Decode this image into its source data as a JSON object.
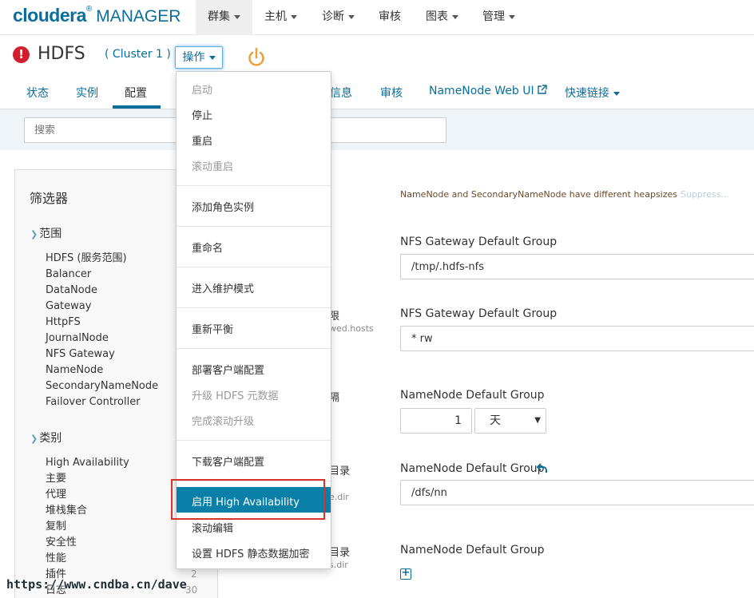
{
  "brand": {
    "name_bold": "cloudera",
    "registered": "®",
    "name_rest": "MANAGER"
  },
  "topnav": [
    {
      "label": "群集",
      "active": true
    },
    {
      "label": "主机"
    },
    {
      "label": "诊断"
    },
    {
      "label": "审核"
    },
    {
      "label": "图表"
    },
    {
      "label": "管理"
    }
  ],
  "service": {
    "title": "HDFS",
    "cluster": "( Cluster 1 )",
    "ops_label": "操作",
    "status_icon": "error-icon",
    "power_icon": "power-icon",
    "power_color": "#e8a33d"
  },
  "tabs": {
    "status": "状态",
    "instances": "实例",
    "config": "配置",
    "info": "信息",
    "audit": "审核",
    "webui": "NameNode Web UI",
    "quicklinks": "快速链接"
  },
  "search": {
    "placeholder": "搜索"
  },
  "filter": {
    "title": "筛选器",
    "scope_head": "范围",
    "scope_items": [
      "HDFS (服务范围)",
      "Balancer",
      "DataNode",
      "Gateway",
      "HttpFS",
      "JournalNode",
      "NFS Gateway",
      "NameNode",
      "SecondaryNameNode",
      "Failover Controller"
    ],
    "category_head": "类别",
    "category_items": [
      "High Availability",
      "主要",
      "代理",
      "堆栈集合",
      "复制",
      "安全性",
      "性能",
      "插件",
      "日志"
    ],
    "count_plugin": "2",
    "count_log": "30"
  },
  "settings": {
    "warning": "NameNode and SecondaryNameNode have different heapsizes",
    "suppress": "Suppress...",
    "group1": "NFS Gateway Default Group",
    "value1": "/tmp/.hdfs-nfs",
    "group2": "NFS Gateway Default Group",
    "value2": "* rw",
    "group3": "NameNode Default Group",
    "num_value": "1",
    "unit_value": "天",
    "group4": "NameNode Default Group",
    "value4": "/dfs/nn",
    "group5": "NameNode Default Group",
    "peek1": "限",
    "peek1_sub": "wed.hosts",
    "peek2": "隔",
    "peek3": "目录",
    "peek3_sub": "e.dir",
    "peek4": "目录",
    "peek4_sub": "s.dir"
  },
  "dropdown": {
    "start": "启动",
    "stop": "停止",
    "restart": "重启",
    "rolling_restart": "滚动重启",
    "add_role": "添加角色实例",
    "rename": "重命名",
    "maintenance": "进入维护模式",
    "rebalance": "重新平衡",
    "deploy_client": "部署客户端配置",
    "upgrade_meta": "升级 HDFS 元数据",
    "finish_upgrade": "完成滚动升级",
    "download_client": "下载客户端配置",
    "enable_ha": "启用 High Availability",
    "rolling_edit": "滚动编辑",
    "encrypt": "设置 HDFS 静态数据加密"
  },
  "watermark": "https://www.cndba.cn/dave",
  "colors": {
    "accent": "#0a6e9c",
    "highlight": "#0a7fa8",
    "error": "#d0202f",
    "annotation": "#d9342b"
  }
}
